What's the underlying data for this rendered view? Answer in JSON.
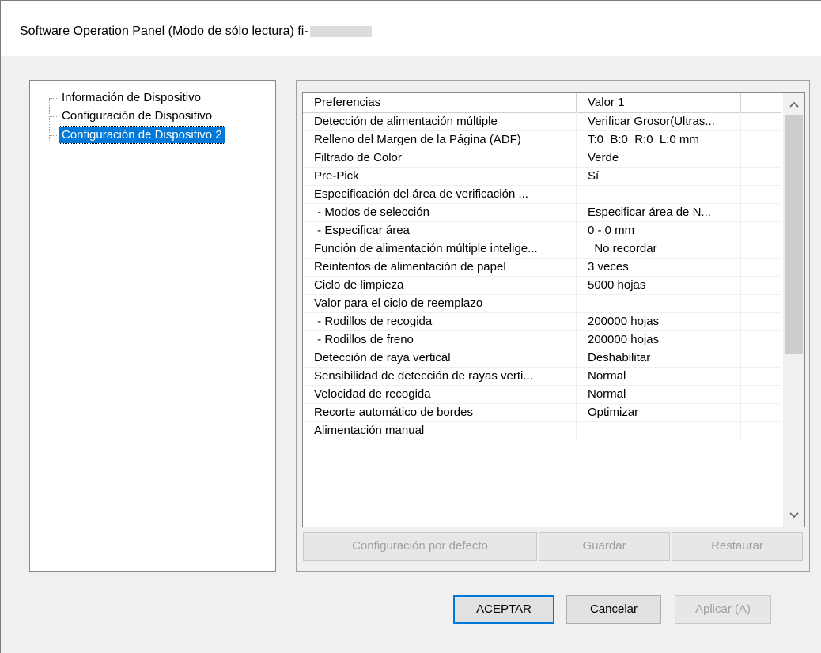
{
  "window": {
    "title": "Software Operation Panel (Modo de sólo lectura) fi-"
  },
  "tree": {
    "items": [
      {
        "label": "Información de Dispositivo"
      },
      {
        "label": "Configuración de Dispositivo"
      },
      {
        "label": "Configuración de Dispositivo 2",
        "selected": true
      }
    ]
  },
  "grid": {
    "headers": [
      "Preferencias",
      "Valor 1",
      ""
    ],
    "rows": [
      {
        "pref": "Detección de alimentación múltiple",
        "value": "Verificar Grosor(Ultras..."
      },
      {
        "pref": "Relleno del Margen de la Página (ADF)",
        "value": "T:0  B:0  R:0  L:0 mm"
      },
      {
        "pref": "Filtrado de Color",
        "value": "Verde"
      },
      {
        "pref": "Pre-Pick",
        "value": "Sí"
      },
      {
        "pref": "Especificación del área de verificación ...",
        "value": ""
      },
      {
        "pref": " - Modos de selección",
        "value": "Especificar área de N..."
      },
      {
        "pref": " - Especificar área",
        "value": "0 - 0 mm"
      },
      {
        "pref": "Función de alimentación múltiple intelige...",
        "value": "  No recordar"
      },
      {
        "pref": "Reintentos de alimentación de papel",
        "value": "3 veces"
      },
      {
        "pref": "Ciclo de limpieza",
        "value": "5000 hojas"
      },
      {
        "pref": "Valor para el ciclo de reemplazo",
        "value": ""
      },
      {
        "pref": " - Rodillos de recogida",
        "value": "200000 hojas"
      },
      {
        "pref": " - Rodillos de freno",
        "value": "200000 hojas"
      },
      {
        "pref": "Detección de raya vertical",
        "value": "Deshabilitar"
      },
      {
        "pref": "Sensibilidad de detección de rayas verti...",
        "value": "Normal"
      },
      {
        "pref": "Velocidad de recogida",
        "value": "Normal"
      },
      {
        "pref": "Recorte automático de bordes",
        "value": "Optimizar"
      },
      {
        "pref": "Alimentación manual",
        "value": ""
      }
    ],
    "scroll_up_icon": "^",
    "scroll_down_icon": "v"
  },
  "group_buttons": {
    "default_config": "Configuración por defecto",
    "save": "Guardar",
    "restore": "Restaurar"
  },
  "dialog_buttons": {
    "ok": "ACEPTAR",
    "cancel": "Cancelar",
    "apply": "Aplicar (A)"
  }
}
